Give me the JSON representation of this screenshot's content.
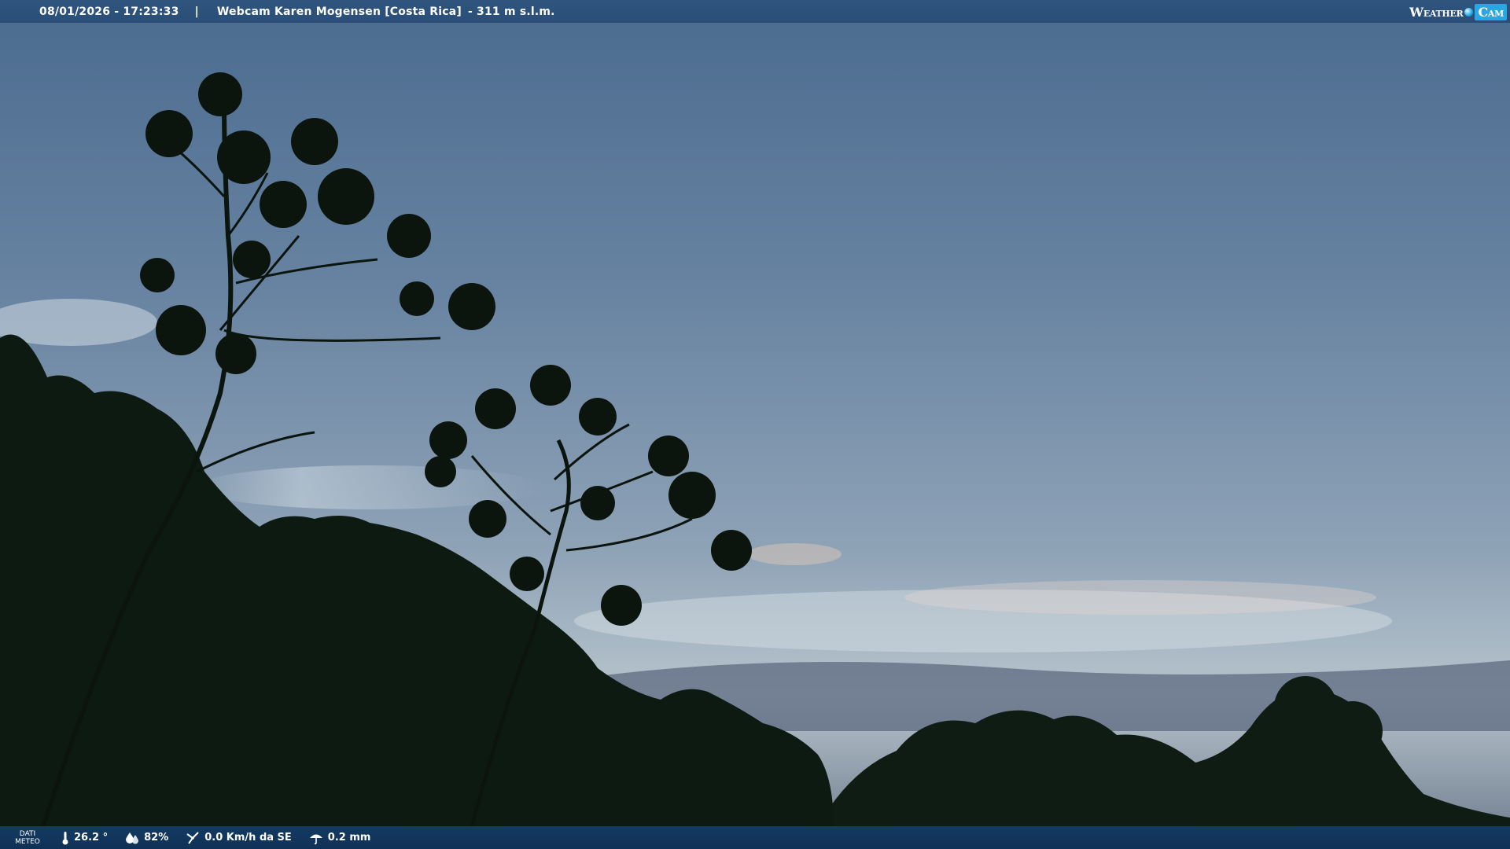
{
  "header": {
    "datetime": "08/01/2026 - 17:23:33",
    "separator": "|",
    "title": "Webcam Karen Mogensen [Costa Rica]",
    "elevation": "- 311 m s.l.m.",
    "logo": {
      "word": "Weather",
      "cam": "Cam"
    }
  },
  "footer": {
    "label_line1": "DATI",
    "label_line2": "METEO",
    "temperature": "26.2 °",
    "humidity": "82%",
    "wind": "0.0 Km/h da SE",
    "rain": "0.2 mm"
  },
  "colors": {
    "top_bar": "#2f557f",
    "bottom_bar": "#143a63",
    "logo_accent": "#2aa6e2",
    "sky_top": "#4f6f92",
    "sky_horizon": "#bcc8d0",
    "foliage": "#0d1a12"
  },
  "icons": [
    "thermometer-icon",
    "humidity-drop-icon",
    "wind-icon",
    "rain-umbrella-icon"
  ]
}
